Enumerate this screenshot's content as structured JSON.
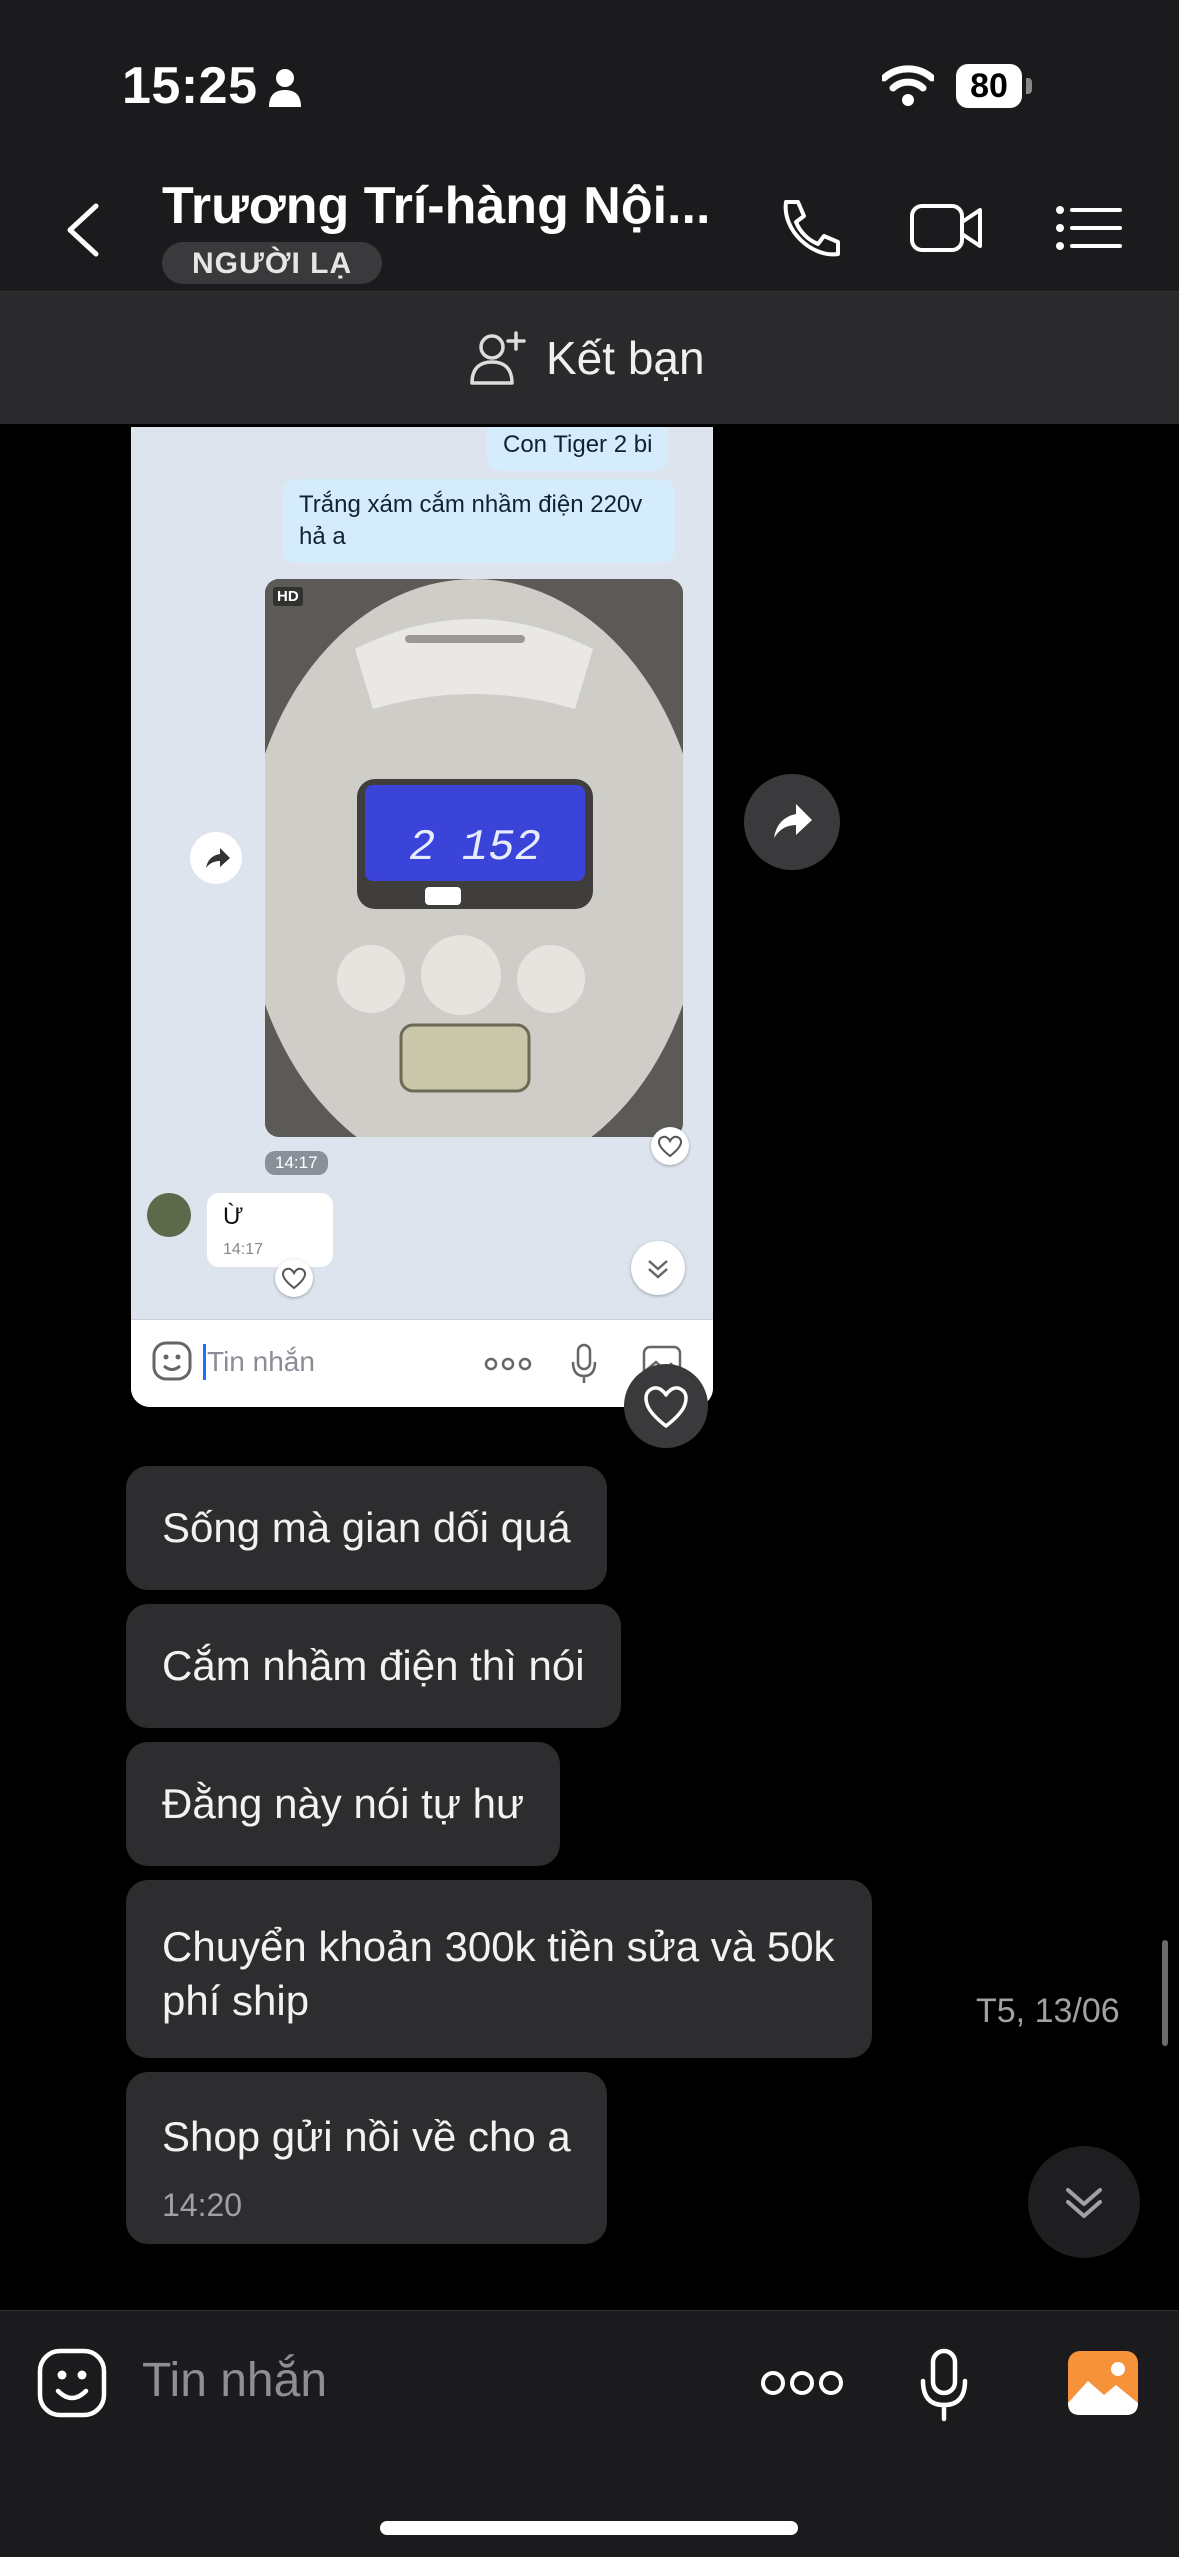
{
  "status_bar": {
    "time": "15:25",
    "battery": "80"
  },
  "header": {
    "title": "Trương Trí-hàng Nội...",
    "badge": "NGƯỜI LẠ",
    "icons": [
      "chevron-left-icon",
      "phone-icon",
      "video-camera-icon",
      "list-menu-icon"
    ]
  },
  "friend_bar": {
    "label": "Kết bạn",
    "icon": "add-friend-icon"
  },
  "screenshot": {
    "bubble_1": "Con Tiger 2 bi",
    "bubble_2": "Trắng xám cắm nhầm điện 220v hả a",
    "photo_hd": "HD",
    "photo_time": "14:17",
    "reply_text": "Ừ",
    "reply_time": "14:17",
    "input_placeholder": "Tin nhắn"
  },
  "messages": [
    {
      "text": "Sống mà gian dối quá"
    },
    {
      "text": "Cắm nhầm điện thì nói"
    },
    {
      "text": "Đằng này nói tự hư"
    },
    {
      "text": "Chuyển khoản 300k tiền sửa và 50k phí ship"
    },
    {
      "text": "Shop gửi nồi về cho a",
      "time": "14:20"
    }
  ],
  "date_label": "T5, 13/06",
  "input": {
    "placeholder": "Tin nhắn"
  },
  "colors": {
    "background": "#000000",
    "bar": "#1b1b1d",
    "bubble": "#2d2d2f",
    "gallery_accent": "#f5923a"
  }
}
